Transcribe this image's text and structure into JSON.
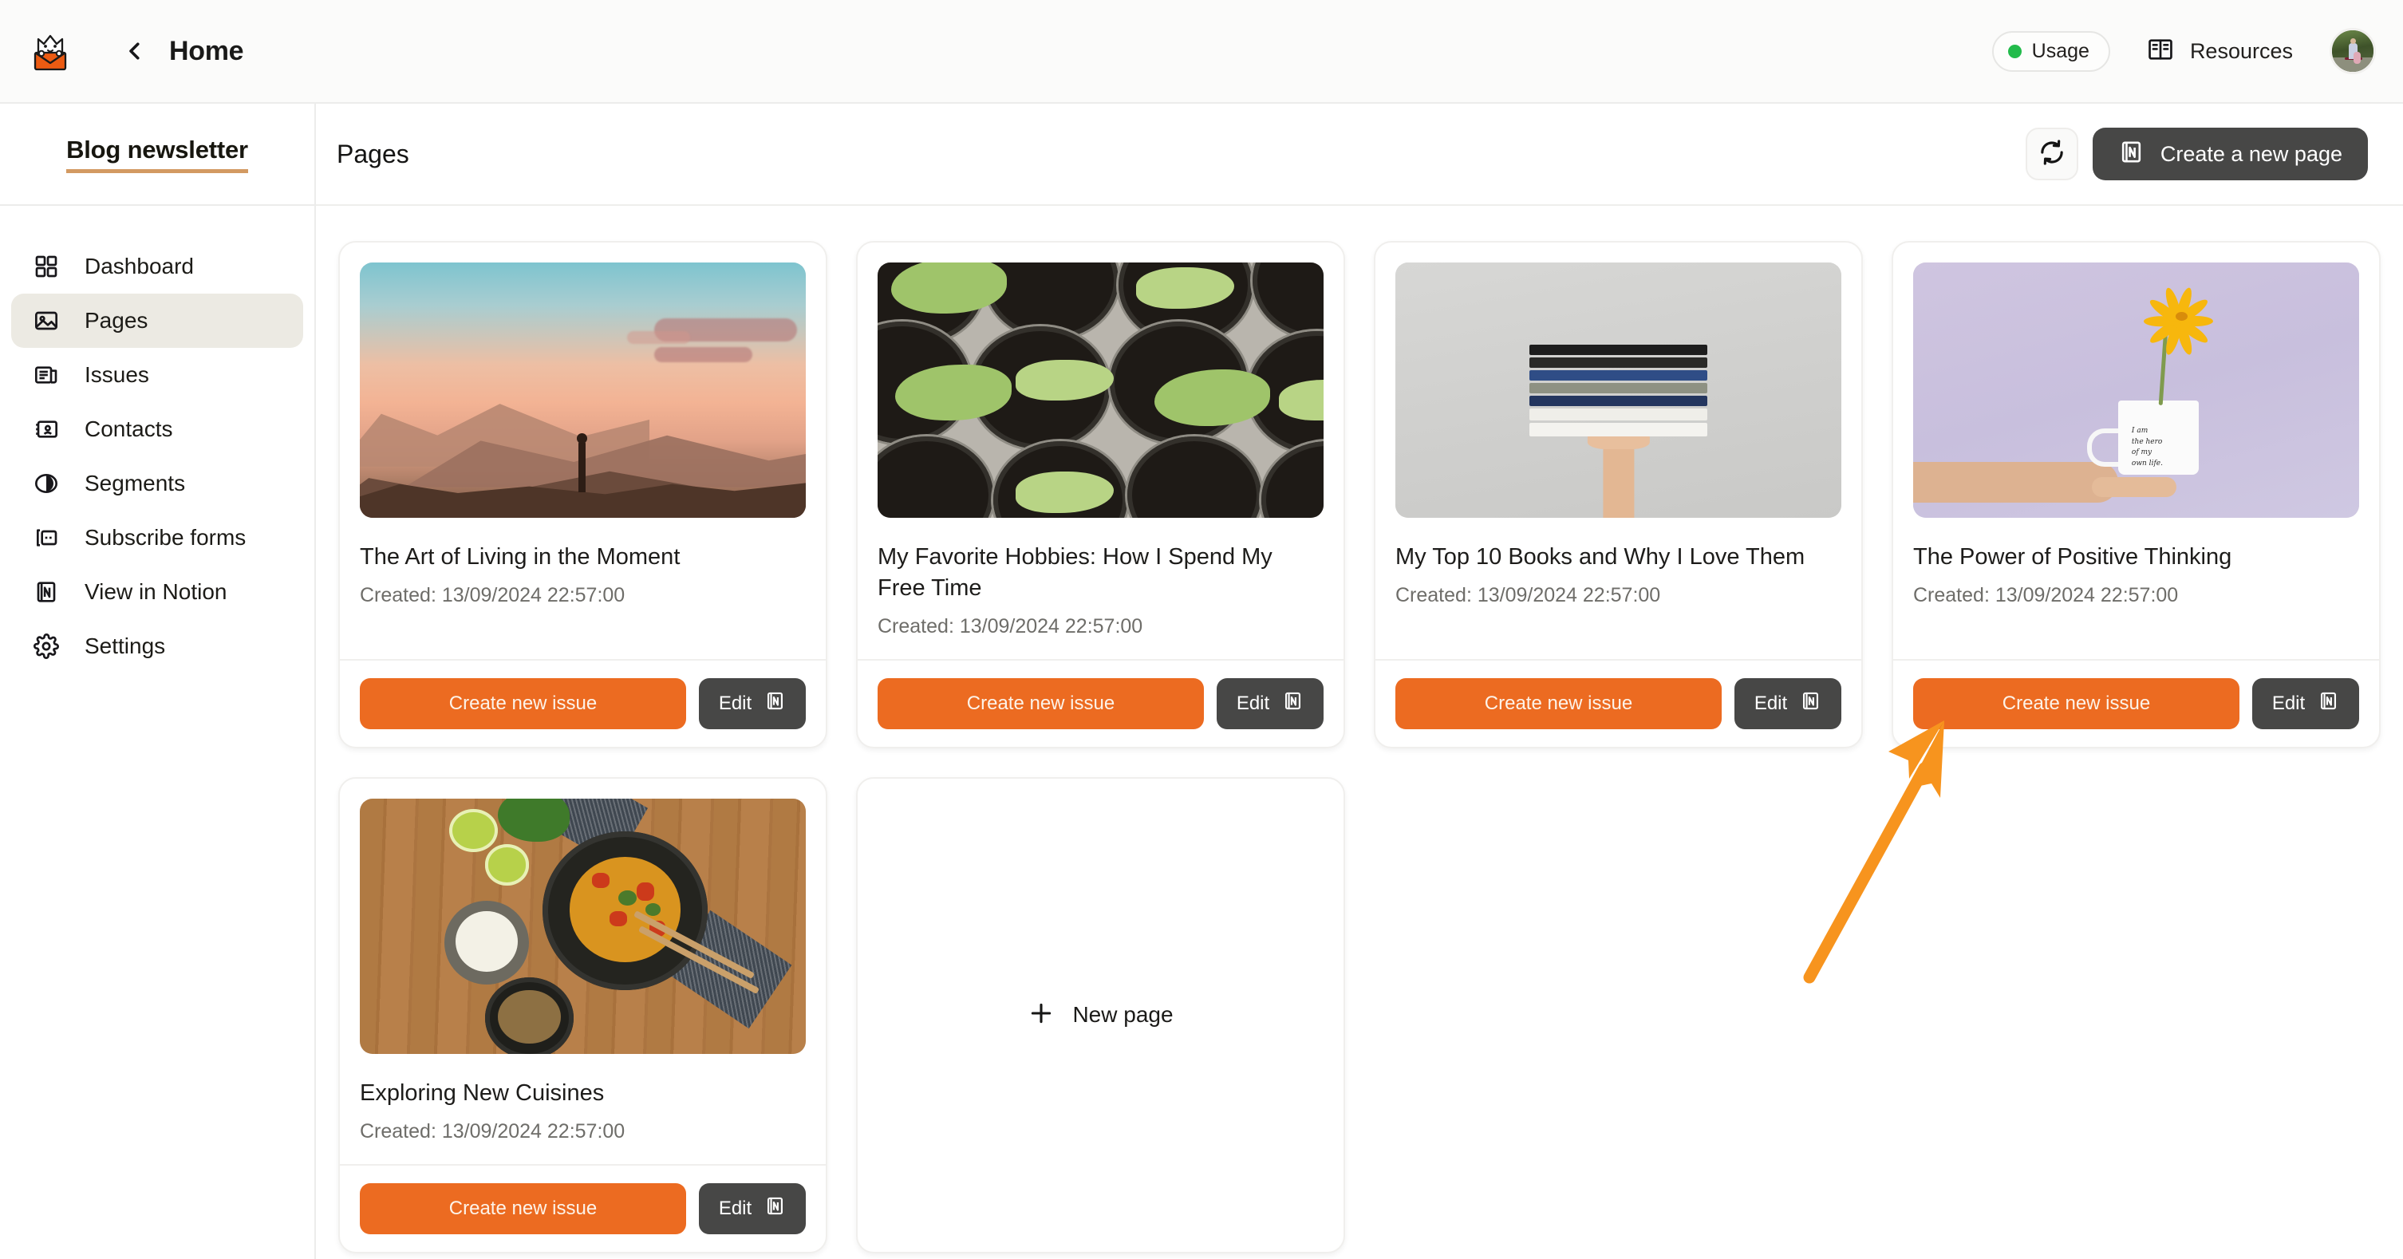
{
  "topbar": {
    "logo_icon": "cat-in-envelope-logo",
    "back_icon": "chevron-left-icon",
    "title": "Home",
    "usage_label": "Usage",
    "usage_dot_color": "#22bb4b",
    "resources_label": "Resources",
    "resources_icon": "book-icon",
    "avatar_icon": "user-avatar"
  },
  "sidebar": {
    "brand": "Blog newsletter",
    "brand_underline_color": "#d39a62",
    "items": [
      {
        "label": "Dashboard",
        "icon": "grid-icon",
        "active": false
      },
      {
        "label": "Pages",
        "icon": "image-icon",
        "active": true
      },
      {
        "label": "Issues",
        "icon": "newspaper-icon",
        "active": false
      },
      {
        "label": "Contacts",
        "icon": "contact-card-icon",
        "active": false
      },
      {
        "label": "Segments",
        "icon": "pie-chart-icon",
        "active": false
      },
      {
        "label": "Subscribe forms",
        "icon": "form-icon",
        "active": false
      },
      {
        "label": "View in Notion",
        "icon": "notion-icon",
        "active": false
      },
      {
        "label": "Settings",
        "icon": "gear-icon",
        "active": false
      }
    ]
  },
  "toolbar": {
    "title": "Pages",
    "refresh_icon": "refresh-icon",
    "create_page_label": "Create a new page",
    "create_page_icon": "notion-icon"
  },
  "card_actions": {
    "create_issue_label": "Create new issue",
    "edit_label": "Edit",
    "edit_icon": "notion-icon",
    "accent_color": "#ec6b21",
    "edit_bg_color": "#474746"
  },
  "new_page_card": {
    "label": "New page",
    "icon": "plus-icon"
  },
  "cards": [
    {
      "title": "The Art of Living in the Moment",
      "created": "Created: 13/09/2024 22:57:00",
      "thumb": "sunset-mountains-hiker-photo"
    },
    {
      "title": "My Favorite Hobbies: How I Spend My Free Time",
      "created": "Created: 13/09/2024 22:57:00",
      "thumb": "seedlings-in-pots-photo"
    },
    {
      "title": "My Top 10 Books and Why I Love Them",
      "created": "Created: 13/09/2024 22:57:00",
      "thumb": "hand-holding-books-photo"
    },
    {
      "title": "The Power of Positive Thinking",
      "created": "Created: 13/09/2024 22:57:00",
      "thumb": "hand-holding-mug-with-flower-photo"
    },
    {
      "title": "Exploring New Cuisines",
      "created": "Created: 13/09/2024 22:57:00",
      "thumb": "thai-curry-meal-photo"
    }
  ],
  "annotation": {
    "arrow_color": "#f7941e",
    "points_to": "create-new-issue-button-card-4"
  }
}
